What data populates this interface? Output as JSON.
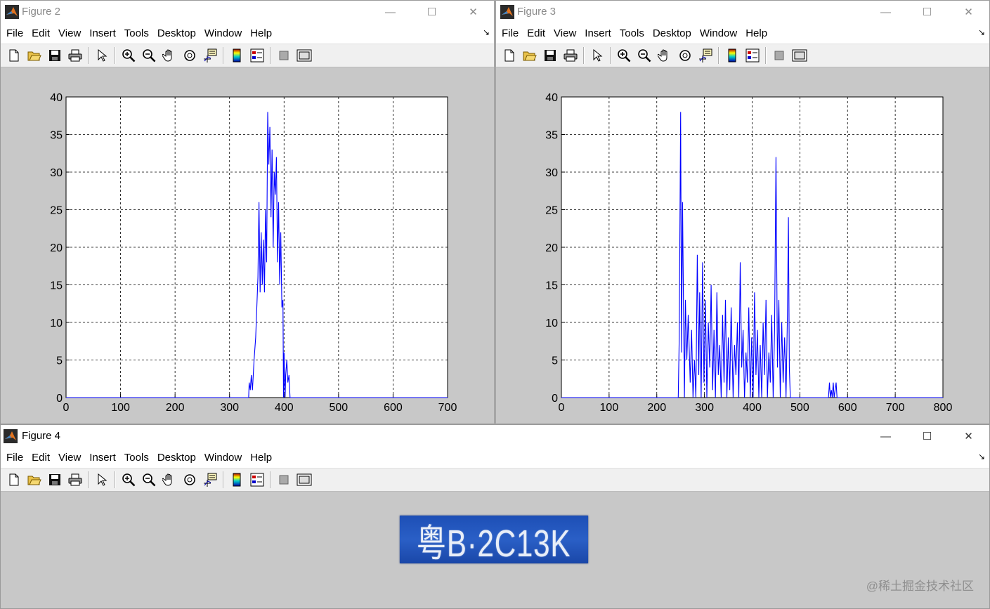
{
  "menu_items": [
    "File",
    "Edit",
    "View",
    "Insert",
    "Tools",
    "Desktop",
    "Window",
    "Help"
  ],
  "window_buttons": {
    "minimize": "—",
    "maximize": "☐",
    "close": "✕"
  },
  "toolbar_icons": [
    "new-figure-icon",
    "open-file-icon",
    "save-icon",
    "print-icon",
    "edit-plot-arrow-icon",
    "zoom-in-icon",
    "zoom-out-icon",
    "pan-hand-icon",
    "rotate-3d-icon",
    "data-cursor-icon",
    "colorbar-icon",
    "legend-icon",
    "hide-plot-tools-icon",
    "show-plot-tools-icon"
  ],
  "figures": {
    "fig2": {
      "title": "Figure 2"
    },
    "fig3": {
      "title": "Figure 3"
    },
    "fig4": {
      "title": "Figure 4",
      "plate_text": "粤B·2C13K"
    }
  },
  "watermark": "@稀土掘金技术社区",
  "colors": {
    "line": "#0000ff",
    "titlebar": "#ffffff",
    "figure_bg": "#c8c8c8",
    "plate": "#2358c0"
  },
  "chart_data": [
    {
      "type": "line",
      "figure": "Figure 2",
      "xlim": [
        0,
        700
      ],
      "ylim": [
        0,
        40
      ],
      "xticks": [
        0,
        100,
        200,
        300,
        400,
        500,
        600,
        700
      ],
      "yticks": [
        0,
        5,
        10,
        15,
        20,
        25,
        30,
        35,
        40
      ],
      "grid": true,
      "series": [
        {
          "x": [
            0,
            335,
            336,
            338,
            340,
            342,
            345,
            348,
            350,
            352,
            354,
            356,
            358,
            360,
            362,
            364,
            366,
            368,
            370,
            372,
            374,
            376,
            378,
            380,
            382,
            384,
            386,
            388,
            390,
            392,
            394,
            396,
            398,
            399,
            400,
            401,
            402,
            403,
            405,
            407,
            409,
            411,
            413,
            700
          ],
          "y": [
            0,
            0,
            2,
            1,
            3,
            1,
            5,
            8,
            12,
            16,
            26,
            14,
            22,
            15,
            21,
            14,
            25,
            18,
            38,
            31,
            36,
            24,
            33,
            20,
            30,
            27,
            32,
            18,
            26,
            15,
            22,
            12,
            13,
            0,
            6,
            2,
            0,
            3,
            5,
            2,
            3,
            0,
            0,
            0
          ]
        }
      ]
    },
    {
      "type": "line",
      "figure": "Figure 3",
      "xlim": [
        0,
        800
      ],
      "ylim": [
        0,
        40
      ],
      "xticks": [
        0,
        100,
        200,
        300,
        400,
        500,
        600,
        700,
        800
      ],
      "yticks": [
        0,
        5,
        10,
        15,
        20,
        25,
        30,
        35,
        40
      ],
      "grid": true,
      "series": [
        {
          "x": [
            0,
            245,
            247,
            250,
            252,
            254,
            256,
            258,
            260,
            263,
            266,
            270,
            273,
            276,
            279,
            282,
            285,
            288,
            290,
            293,
            296,
            299,
            302,
            305,
            308,
            311,
            314,
            317,
            320,
            323,
            326,
            329,
            332,
            335,
            338,
            341,
            344,
            347,
            350,
            353,
            356,
            360,
            363,
            366,
            369,
            372,
            375,
            378,
            381,
            384,
            387,
            390,
            393,
            396,
            399,
            402,
            405,
            408,
            411,
            414,
            417,
            420,
            423,
            426,
            429,
            432,
            435,
            438,
            441,
            444,
            447,
            450,
            453,
            456,
            459,
            462,
            465,
            468,
            471,
            474,
            476,
            478,
            480,
            560,
            562,
            564,
            566,
            568,
            570,
            572,
            574,
            576,
            578,
            800
          ],
          "y": [
            0,
            0,
            8,
            38,
            6,
            26,
            12,
            0,
            13,
            5,
            11,
            2,
            9,
            0,
            5,
            0,
            19,
            3,
            14,
            0,
            18,
            2,
            13,
            0,
            10,
            4,
            15,
            1,
            9,
            0,
            14,
            3,
            7,
            0,
            11,
            2,
            13,
            0,
            8,
            1,
            12,
            0,
            7,
            3,
            10,
            0,
            18,
            4,
            9,
            0,
            6,
            2,
            12,
            0,
            8,
            0,
            14,
            3,
            9,
            0,
            7,
            0,
            10,
            3,
            13,
            0,
            6,
            2,
            11,
            0,
            9,
            32,
            4,
            13,
            0,
            10,
            2,
            8,
            0,
            11,
            24,
            4,
            0,
            0,
            2,
            0,
            1,
            0,
            2,
            0,
            1,
            2,
            0,
            0
          ]
        }
      ]
    }
  ]
}
